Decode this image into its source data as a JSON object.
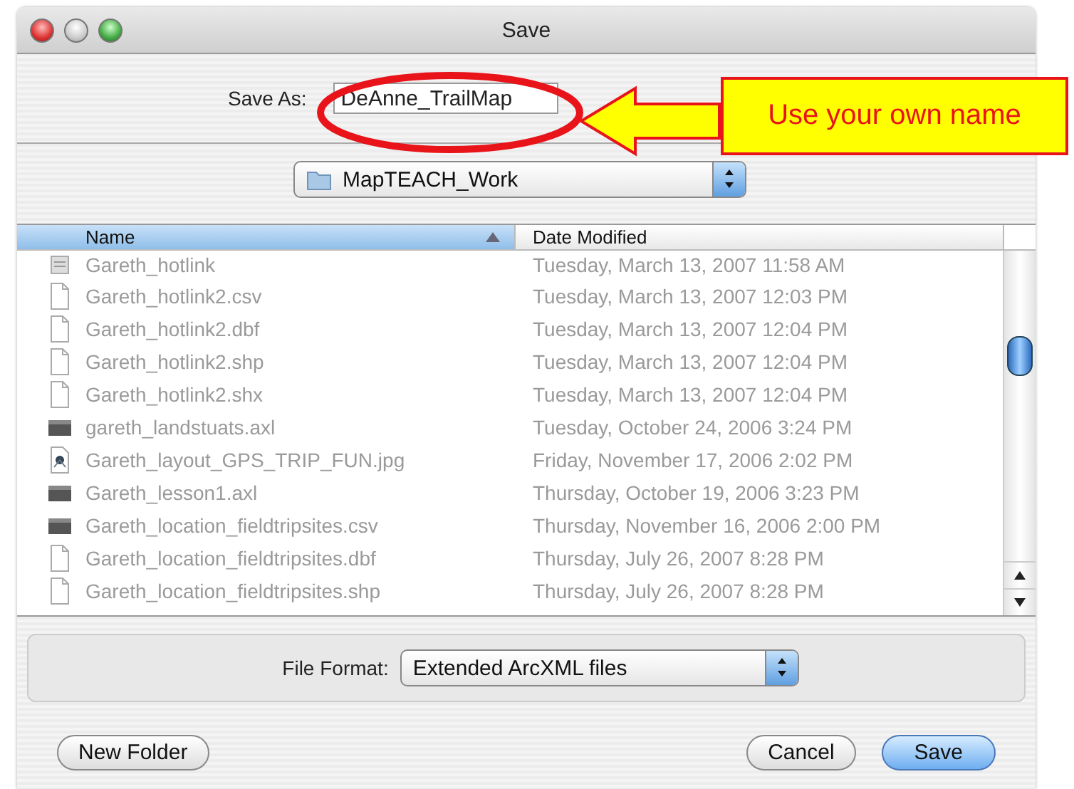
{
  "window": {
    "title": "Save"
  },
  "save_as": {
    "label": "Save As:",
    "value": "DeAnne_TrailMap"
  },
  "location": {
    "value": "MapTEACH_Work"
  },
  "table": {
    "columns": [
      {
        "label": "Name",
        "sorted": true
      },
      {
        "label": "Date Modified",
        "sorted": false
      }
    ],
    "rows": [
      {
        "name": "Gareth_hotlink",
        "date": "Tuesday, March 13, 2007 11:58 AM",
        "kind": "generic",
        "disabled": true
      },
      {
        "name": "Gareth_hotlink2.csv",
        "date": "Tuesday, March 13, 2007 12:03 PM",
        "kind": "document",
        "disabled": true
      },
      {
        "name": "Gareth_hotlink2.dbf",
        "date": "Tuesday, March 13, 2007 12:04 PM",
        "kind": "document",
        "disabled": true
      },
      {
        "name": "Gareth_hotlink2.shp",
        "date": "Tuesday, March 13, 2007 12:04 PM",
        "kind": "document",
        "disabled": true
      },
      {
        "name": "Gareth_hotlink2.shx",
        "date": "Tuesday, March 13, 2007 12:04 PM",
        "kind": "document",
        "disabled": true
      },
      {
        "name": "gareth_landstuats.axl",
        "date": "Tuesday, October 24, 2006 3:24 PM",
        "kind": "dark",
        "disabled": true
      },
      {
        "name": "Gareth_layout_GPS_TRIP_FUN.jpg",
        "date": "Friday, November 17, 2006 2:02 PM",
        "kind": "image",
        "disabled": true
      },
      {
        "name": "Gareth_lesson1.axl",
        "date": "Thursday, October 19, 2006 3:23 PM",
        "kind": "dark",
        "disabled": true
      },
      {
        "name": "Gareth_location_fieldtripsites.csv",
        "date": "Thursday, November 16, 2006 2:00 PM",
        "kind": "dark",
        "disabled": true
      },
      {
        "name": "Gareth_location_fieldtripsites.dbf",
        "date": "Thursday, July 26, 2007 8:28 PM",
        "kind": "document",
        "disabled": true
      },
      {
        "name": "Gareth_location_fieldtripsites.shp",
        "date": "Thursday, July 26, 2007 8:28 PM",
        "kind": "document",
        "disabled": true
      }
    ]
  },
  "file_format": {
    "label": "File Format:",
    "value": "Extended ArcXML files"
  },
  "buttons": [
    {
      "label": "New Folder",
      "default": false
    },
    {
      "label": "Cancel",
      "default": false
    },
    {
      "label": "Save",
      "default": true
    }
  ],
  "annotation": {
    "text": "Use your own name"
  }
}
